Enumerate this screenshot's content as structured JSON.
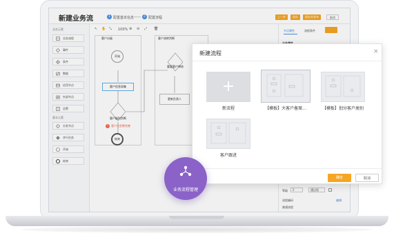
{
  "header": {
    "title": "新建业务流",
    "steps": [
      {
        "num": "1",
        "label": "配置基本信息"
      },
      {
        "num": "2",
        "label": "配置流程"
      }
    ],
    "buttons": {
      "prev": "上一步",
      "save": "保存",
      "save_publish": "保存并发布",
      "cancel": "取消"
    }
  },
  "sidebar": {
    "section1": "业务元素",
    "items1": [
      "业务流程",
      "事件",
      "条件",
      "数据",
      "应用节点",
      "外部节点",
      "告警"
    ],
    "section2": "基本元素",
    "items2": [
      "分发节点",
      "并行任务",
      "开始",
      "结束"
    ]
  },
  "toolbar": {
    "zoom": "100%"
  },
  "canvas": {
    "lane1": "客户分级",
    "lane2": "客户流转判断",
    "start": "开始",
    "task1": "客户信息采集",
    "decision1": "客户级别判断",
    "warning": "客户信息需完善",
    "end": "结束",
    "decision2": "重要客户审核",
    "task2": "更新负责人"
  },
  "right_panel": {
    "tabs": [
      "节点属性",
      "流程条件"
    ],
    "section": "业务属性",
    "field1_label": "等级",
    "field1_value": "2",
    "field2_value": "通过现",
    "field3": "流程编码",
    "field4": "普通流程",
    "link": "编辑"
  },
  "modal": {
    "title": "新建流程",
    "cards": [
      "新流程",
      "【模板】大客户备案...",
      "【模板】划分客户类别",
      "客户跟进"
    ],
    "confirm": "确定",
    "cancel": "取消"
  },
  "badge": {
    "label": "业务流程管理"
  },
  "colors": {
    "accent": "#f5a623",
    "purple": "#8a62c8",
    "blue": "#4a90e2"
  }
}
